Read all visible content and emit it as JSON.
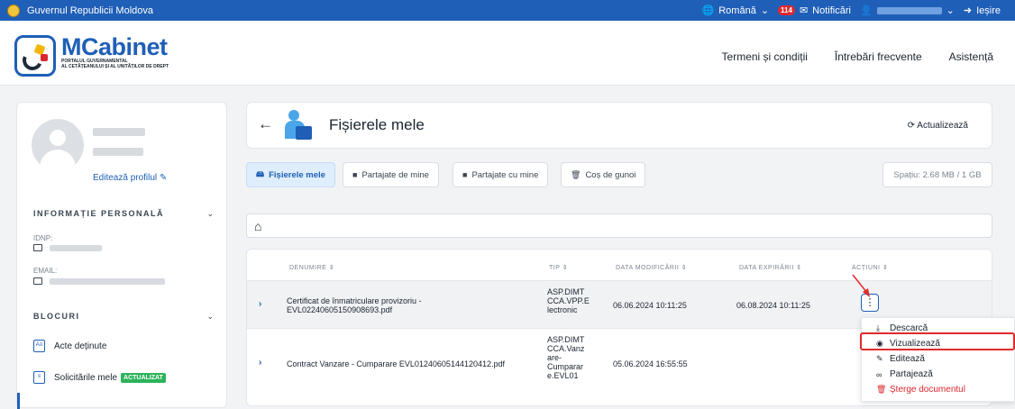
{
  "topbar": {
    "gov": "Guvernul Republicii Moldova",
    "language": "Română",
    "notif_count": "114",
    "notif_label": "Notificări",
    "logout": "Ieșire"
  },
  "header": {
    "logo_title": "MCabinet",
    "logo_sub1": "PORTALUL GUVERNAMENTAL",
    "logo_sub2": "AL CETĂȚEANULUI ȘI AL UNITĂȚILOR DE DREPT",
    "nav": [
      "Termeni și condiții",
      "Întrebări frecvente",
      "Asistență"
    ]
  },
  "sidebar": {
    "edit_profile": "Editează profilul",
    "section_personal": "INFORMAȚIE PERSONALĂ",
    "idnp_label": "IDNP:",
    "email_label": "EMAIL:",
    "section_blocks": "BLOCURI",
    "items": [
      {
        "label": "Acte deținute"
      },
      {
        "label": "Solicitările mele",
        "badge": "ACTUALIZAT"
      }
    ]
  },
  "panel": {
    "title": "Fișierele mele",
    "refresh": "Actualizează"
  },
  "tabs": [
    "Fișierele mele",
    "Partajate de mine",
    "Partajate cu mine",
    "Coș de gunoi"
  ],
  "space": "Spațiu: 2.68 MB / 1 GB",
  "table": {
    "headers": [
      "DENUMIRE ⇕",
      "TIP ⇕",
      "DATA MODIFICĂRII ⇕",
      "DATA EXPIRĂRII ⇕",
      "ACȚIUNI ⇕"
    ],
    "rows": [
      {
        "name": "Certificat de înmatriculare provizoriu -\nEVL02240605150908693.pdf",
        "type": "ASP.DIMT\nCCA.VPP.E\nlectronic",
        "modified": "06.06.2024 10:11:25",
        "expires": "06.08.2024 10:11:25"
      },
      {
        "name": "Contract Vanzare - Cumparare EVL01240605144120412.pdf",
        "type": "ASP.DIMT\nCCA.Vanz\nare-\nCumparar\ne.EVL01",
        "modified": "05.06.2024 16:55:55",
        "expires": ""
      }
    ]
  },
  "dropdown": [
    "Descarcă",
    "Vizualizează",
    "Editează",
    "Partajează",
    "Șterge documentul"
  ]
}
